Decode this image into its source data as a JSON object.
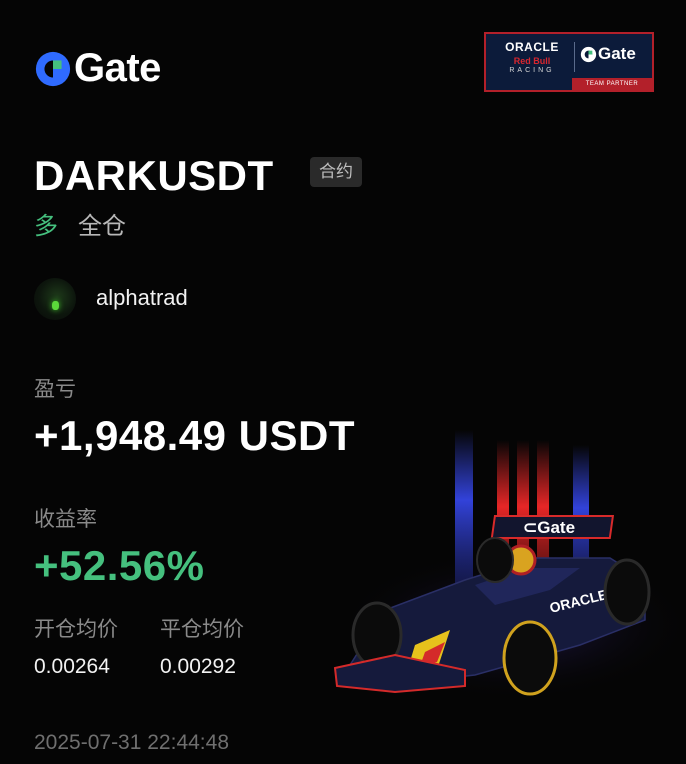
{
  "brand": {
    "name": "Gate",
    "color": "#2f6bff",
    "accent": "#45c07e"
  },
  "partner": {
    "oracle": "ORACLE",
    "red_bull": "Red Bull",
    "racing": "RACING",
    "gate": "Gate",
    "strip": "TEAM PARTNER"
  },
  "position": {
    "symbol": "DARKUSDT",
    "type_tag": "合约",
    "side": "多",
    "margin_mode": "全仓"
  },
  "user": {
    "name": "alphatrad"
  },
  "pnl": {
    "label": "盈亏",
    "value": "+1,948.49 USDT"
  },
  "roi": {
    "label": "收益率",
    "value": "+52.56%"
  },
  "prices": {
    "open_label": "开仓均价",
    "open_value": "0.00264",
    "close_label": "平仓均价",
    "close_value": "0.00292"
  },
  "timestamp": "2025-07-31 22:44:48",
  "icons": [
    "gate-logo-icon",
    "redbull-car-image"
  ]
}
